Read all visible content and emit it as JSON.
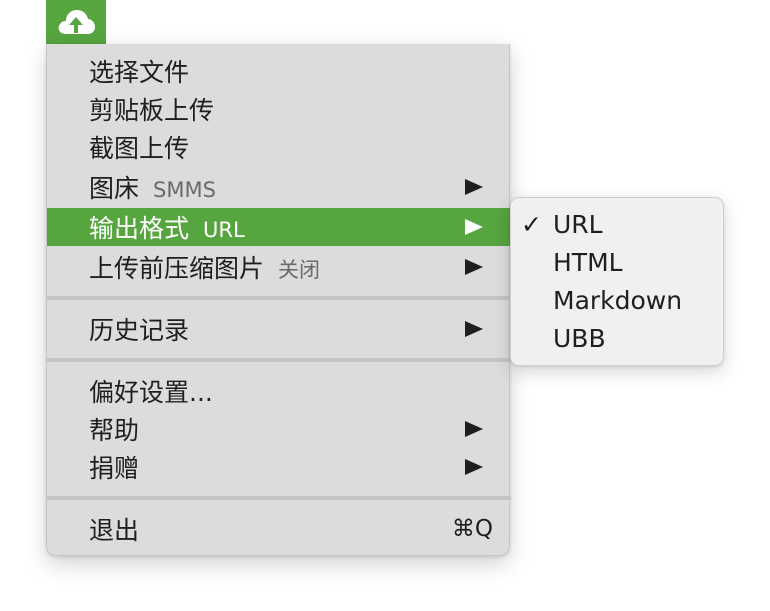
{
  "app": {
    "tray_icon": "cloud-upload-icon",
    "accent_color": "#56a53f"
  },
  "menu": {
    "items": [
      {
        "label": "选择文件"
      },
      {
        "label": "剪贴板上传"
      },
      {
        "label": "截图上传"
      },
      {
        "label": "图床",
        "sub": "SMMS"
      },
      {
        "label": "输出格式",
        "sub": "URL"
      },
      {
        "label": "上传前压缩图片",
        "sub": "关闭"
      },
      {
        "label": "历史记录"
      },
      {
        "label": "偏好设置..."
      },
      {
        "label": "帮助"
      },
      {
        "label": "捐赠"
      },
      {
        "label": "退出",
        "shortcut": "⌘Q"
      }
    ]
  },
  "submenu": {
    "check_mark": "✓",
    "items": [
      {
        "label": "URL",
        "checked": true
      },
      {
        "label": "HTML",
        "checked": false
      },
      {
        "label": "Markdown",
        "checked": false
      },
      {
        "label": "UBB",
        "checked": false
      }
    ]
  }
}
